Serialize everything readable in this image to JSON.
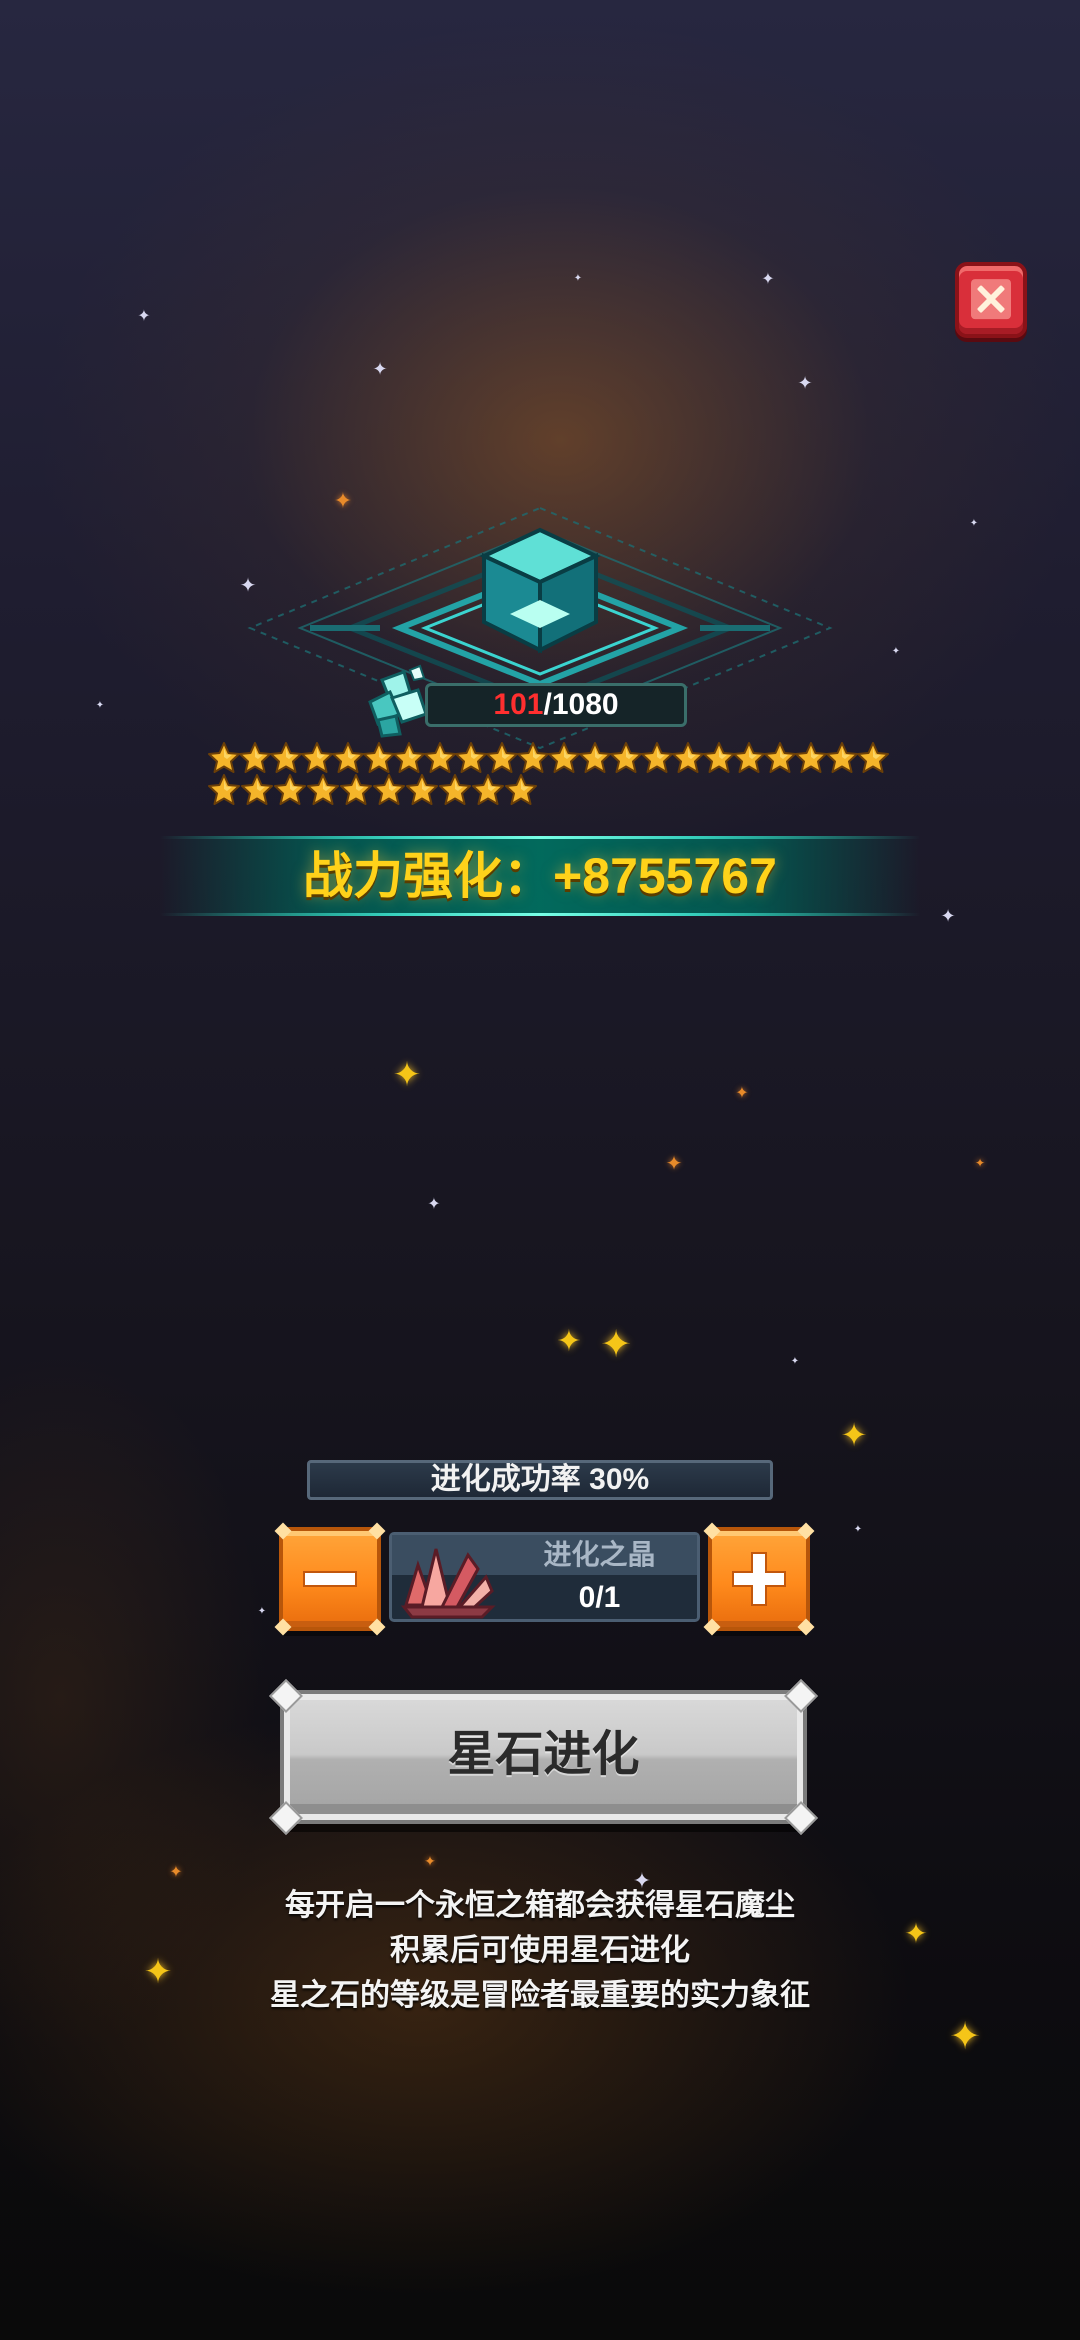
{
  "close_button": {
    "icon": "close-icon",
    "color": "#d92f3a"
  },
  "star_stone": {
    "progress": {
      "current": "101",
      "separator": "/",
      "max": "1080"
    },
    "star_rows": [
      22,
      10
    ],
    "star_color": "#f5b52a"
  },
  "power_banner": {
    "text": "战力强化：+8755767"
  },
  "evolution": {
    "success_rate": "进化成功率 30%",
    "material": {
      "name": "进化之晶",
      "count": "0/1"
    },
    "minus_icon": "minus-icon",
    "plus_icon": "plus-icon",
    "button_label": "星石进化"
  },
  "description": [
    "每开启一个永恒之箱都会获得星石魔尘",
    "积累后可使用星石进化",
    "星之石的等级是冒险者最重要的实力象征"
  ],
  "colors": {
    "accent_gold": "#ffd21a",
    "progress_current": "#ff2f2f",
    "teal": "#1fb3a8",
    "button_orange": "#ff8a1c"
  }
}
